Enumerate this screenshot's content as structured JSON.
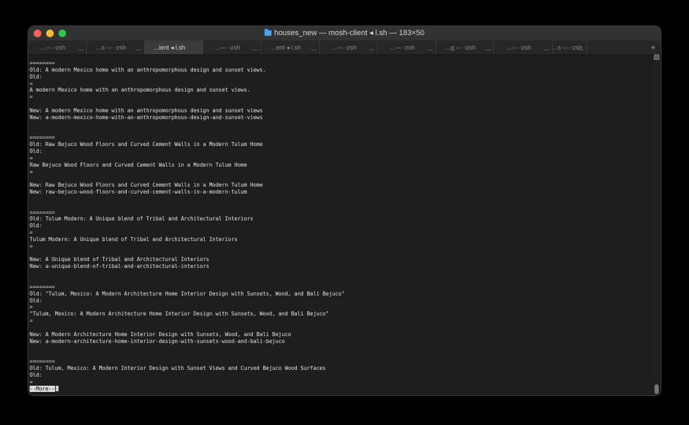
{
  "window": {
    "title": "houses_new — mosh-client ◂ l.sh — 183×50",
    "folder_icon": "folder-icon"
  },
  "tabs": [
    {
      "label": "...— -zsh",
      "more": "..."
    },
    {
      "label": "...s — -zsh",
      "more": "..."
    },
    {
      "label": "...ient ◂ l.sh",
      "more": "",
      "active": true
    },
    {
      "label": "...— -zsh",
      "more": "..."
    },
    {
      "label": "...ent ◂ l.sh",
      "more": "..."
    },
    {
      "label": "...— -zsh",
      "more": "..."
    },
    {
      "label": "...— -zsh",
      "more": "..."
    },
    {
      "label": "...g — -zsh",
      "more": "..."
    },
    {
      "label": "...— -zsh",
      "more": "..."
    },
    {
      "label": "...s — -zsh",
      "more": "..."
    }
  ],
  "new_tab_label": "+",
  "terminal": {
    "lines": [
      "========",
      "Old: A modern Mexico home with an anthropomorphous design and sunset views.",
      "Old:",
      "=",
      "A modern Mexico home with an anthropomorphous design and sunset views.",
      "=",
      "",
      "New: A modern Mexico home with an anthropomorphous design and sunset views",
      "New: a-modern-mexico-home-with-an-anthropomorphous-design-and-sunset-views",
      "",
      "",
      "========",
      "Old: Raw Bejuco Wood Floors and Curved Cement Walls in a Modern Tulum Home",
      "Old:",
      "=",
      "Raw Bejuco Wood Floors and Curved Cement Walls in a Modern Tulum Home",
      "=",
      "",
      "New: Raw Bejuco Wood Floors and Curved Cement Walls in a Modern Tulum Home",
      "New: raw-bejuco-wood-floors-and-curved-cement-walls-in-a-modern-tulum",
      "",
      "",
      "========",
      "Old: Tulum Modern: A Unique blend of Tribal and Architectural Interiors",
      "Old:",
      "=",
      "Tulum Modern: A Unique blend of Tribal and Architectural Interiors",
      "=",
      "",
      "New: A Unique blend of Tribal and Architectural Interiors",
      "New: a-unique-blend-of-tribal-and-architectural-interiors",
      "",
      "",
      "========",
      "Old: \"Tulum, Mexico: A Modern Architecture Home Interior Design with Sunsets, Wood, and Bali Bejuco\"",
      "Old:",
      "=",
      "\"Tulum, Mexico: A Modern Architecture Home Interior Design with Sunsets, Wood, and Bali Bejuco\"",
      "=",
      "",
      "New: A Modern Architecture Home Interior Design with Sunsets, Wood, and Bali Bejuco",
      "New: a-modern-architecture-home-interior-design-with-sunsets-wood-and-bali-bejuco",
      "",
      "",
      "========",
      "Old: Tulum, Mexico: A Modern Interior Design with Sunset Views and Curved Bejuco Wood Surfaces",
      "Old:",
      "="
    ],
    "pager_prompt": "--More--"
  }
}
